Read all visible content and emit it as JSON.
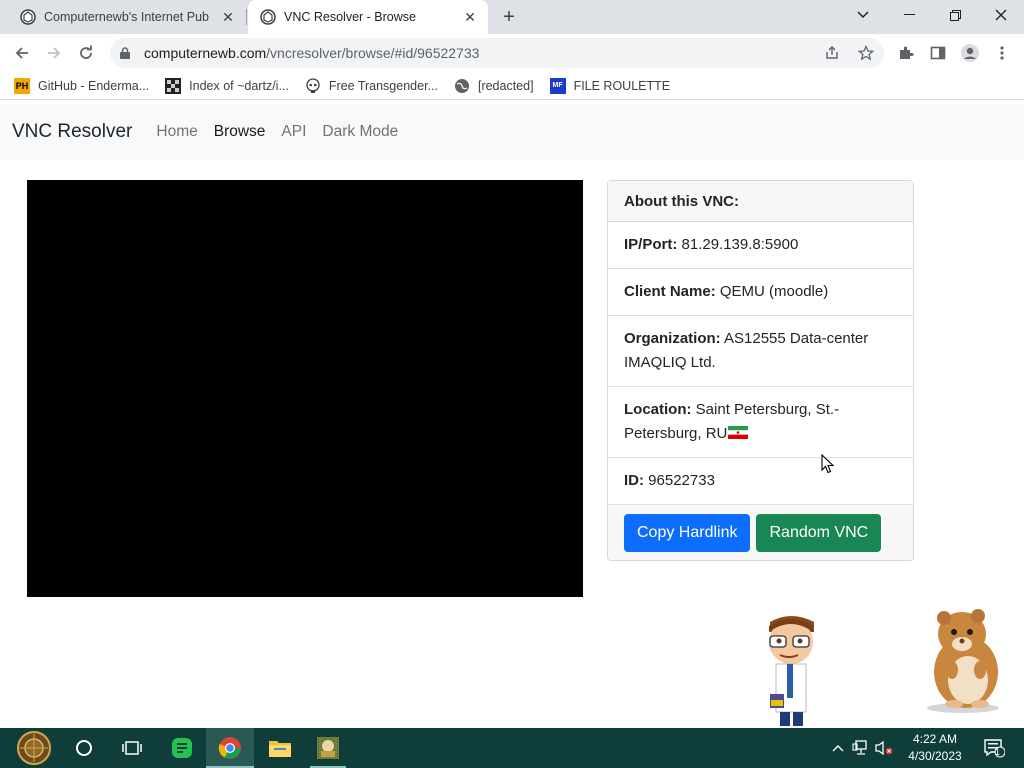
{
  "browser": {
    "tabs": [
      {
        "title": "Computernewb's Internet Pub",
        "active": false
      },
      {
        "title": "VNC Resolver - Browse",
        "active": true
      }
    ],
    "url_host": "computernewb.com",
    "url_path": "/vncresolver/browse/#id/96522733",
    "bookmarks": [
      {
        "label": "GitHub - Enderma...",
        "icon": "PH"
      },
      {
        "label": "Index of ~dartz/i...",
        "icon": "grid"
      },
      {
        "label": "Free Transgender...",
        "icon": "skull"
      },
      {
        "label": "[redacted]",
        "icon": "globe"
      },
      {
        "label": "FILE ROULETTE",
        "icon": "MF"
      }
    ]
  },
  "navbar": {
    "brand": "VNC Resolver",
    "links": [
      {
        "label": "Home",
        "active": false
      },
      {
        "label": "Browse",
        "active": true
      },
      {
        "label": "API",
        "active": false
      },
      {
        "label": "Dark Mode",
        "active": false
      }
    ]
  },
  "card": {
    "header": "About this VNC:",
    "ip_label": "IP/Port:",
    "ip_value": "81.29.139.8:5900",
    "client_label": "Client Name:",
    "client_value": "QEMU (moodle)",
    "org_label": "Organization:",
    "org_value": "AS12555 Data-center IMAQLIQ Ltd.",
    "location_label": "Location:",
    "location_value": "Saint Petersburg, St.-Petersburg, RU",
    "id_label": "ID:",
    "id_value": "96522733",
    "copy_button": "Copy Hardlink",
    "random_button": "Random VNC"
  },
  "taskbar": {
    "time": "4:22 AM",
    "date": "4/30/2023",
    "notification_count": "1"
  },
  "colors": {
    "primary": "#0d6efd",
    "success": "#198754",
    "taskbar": "#0f3d3a"
  }
}
